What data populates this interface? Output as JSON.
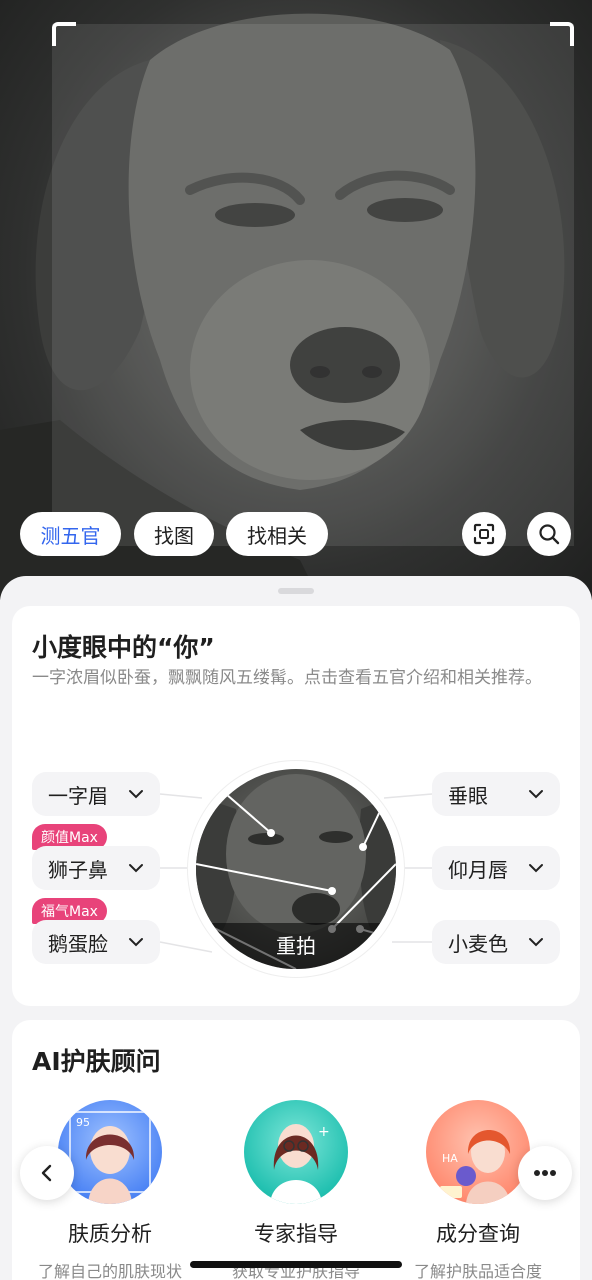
{
  "photo_chips": [
    {
      "label": "测五官",
      "active": true
    },
    {
      "label": "找图",
      "active": false
    },
    {
      "label": "找相关",
      "active": false
    }
  ],
  "photo_buttons": {
    "scan_icon": "scan-icon",
    "search_icon": "search-icon"
  },
  "profile_card": {
    "title": "小度眼中的“你”",
    "description": "一字浓眉似卧蚕，飘飘随风五缕髯。点击查看五官介绍和相关推荐。",
    "features_left": [
      {
        "label": "一字眉",
        "badge": ""
      },
      {
        "label": "狮子鼻",
        "badge": "颜值Max"
      },
      {
        "label": "鹅蛋脸",
        "badge": "福气Max"
      }
    ],
    "features_right": [
      {
        "label": "垂眼"
      },
      {
        "label": "仰月唇"
      },
      {
        "label": "小麦色"
      }
    ],
    "retake_label": "重拍"
  },
  "skin_card": {
    "title": "AI护肤顾问",
    "services": [
      {
        "name": "肤质分析",
        "subtitle": "了解自己的肌肤现状"
      },
      {
        "name": "专家指导",
        "subtitle": "获取专业护肤指导"
      },
      {
        "name": "成分查询",
        "subtitle": "了解护肤品适合度"
      }
    ]
  },
  "colors": {
    "accent": "#3366ee",
    "badge": "#e8437a"
  }
}
